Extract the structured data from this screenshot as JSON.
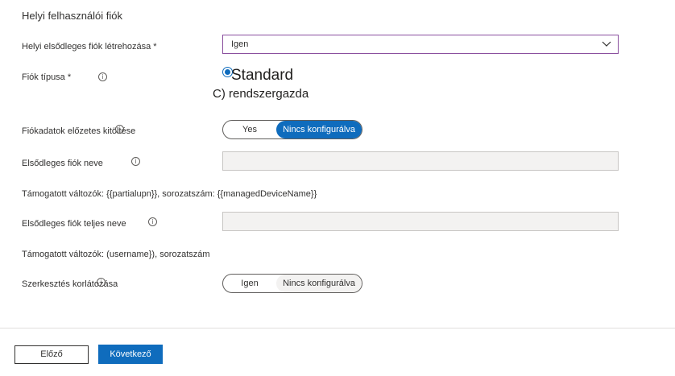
{
  "section": {
    "title": "Helyi felhasználói fiók"
  },
  "fields": {
    "create_account": {
      "label": "Helyi elsődleges fiók létrehozása *",
      "value": "Igen"
    },
    "account_type": {
      "label": "Fiók típusa *",
      "option_1": "Standard",
      "option_2": "C) rendszergazda"
    },
    "prefill": {
      "label": "Fiókadatok előzetes kitöltése",
      "option_left": "Yes",
      "option_right": "Nincs konfigurálva"
    },
    "account_name": {
      "label": "Elsődleges fiók neve",
      "value": "",
      "help": "Támogatott változók: {{partialupn}}, sorozatszám: {{managedDeviceName}}"
    },
    "full_name": {
      "label": "Elsődleges fiók teljes neve",
      "value": "",
      "help": "Támogatott változók: (username}), sorozatszám"
    },
    "restrict_edit": {
      "label": "Szerkesztés korlátozása",
      "option_left": "Igen",
      "option_right": "Nincs konfigurálva"
    }
  },
  "icons": {
    "info": "i",
    "chevron": "chevron-down-icon"
  },
  "footer": {
    "prev_label": "Előző",
    "next_label": "Következő"
  },
  "colors": {
    "accent": "#0f6cbd",
    "select_border": "#8a4f9e"
  }
}
